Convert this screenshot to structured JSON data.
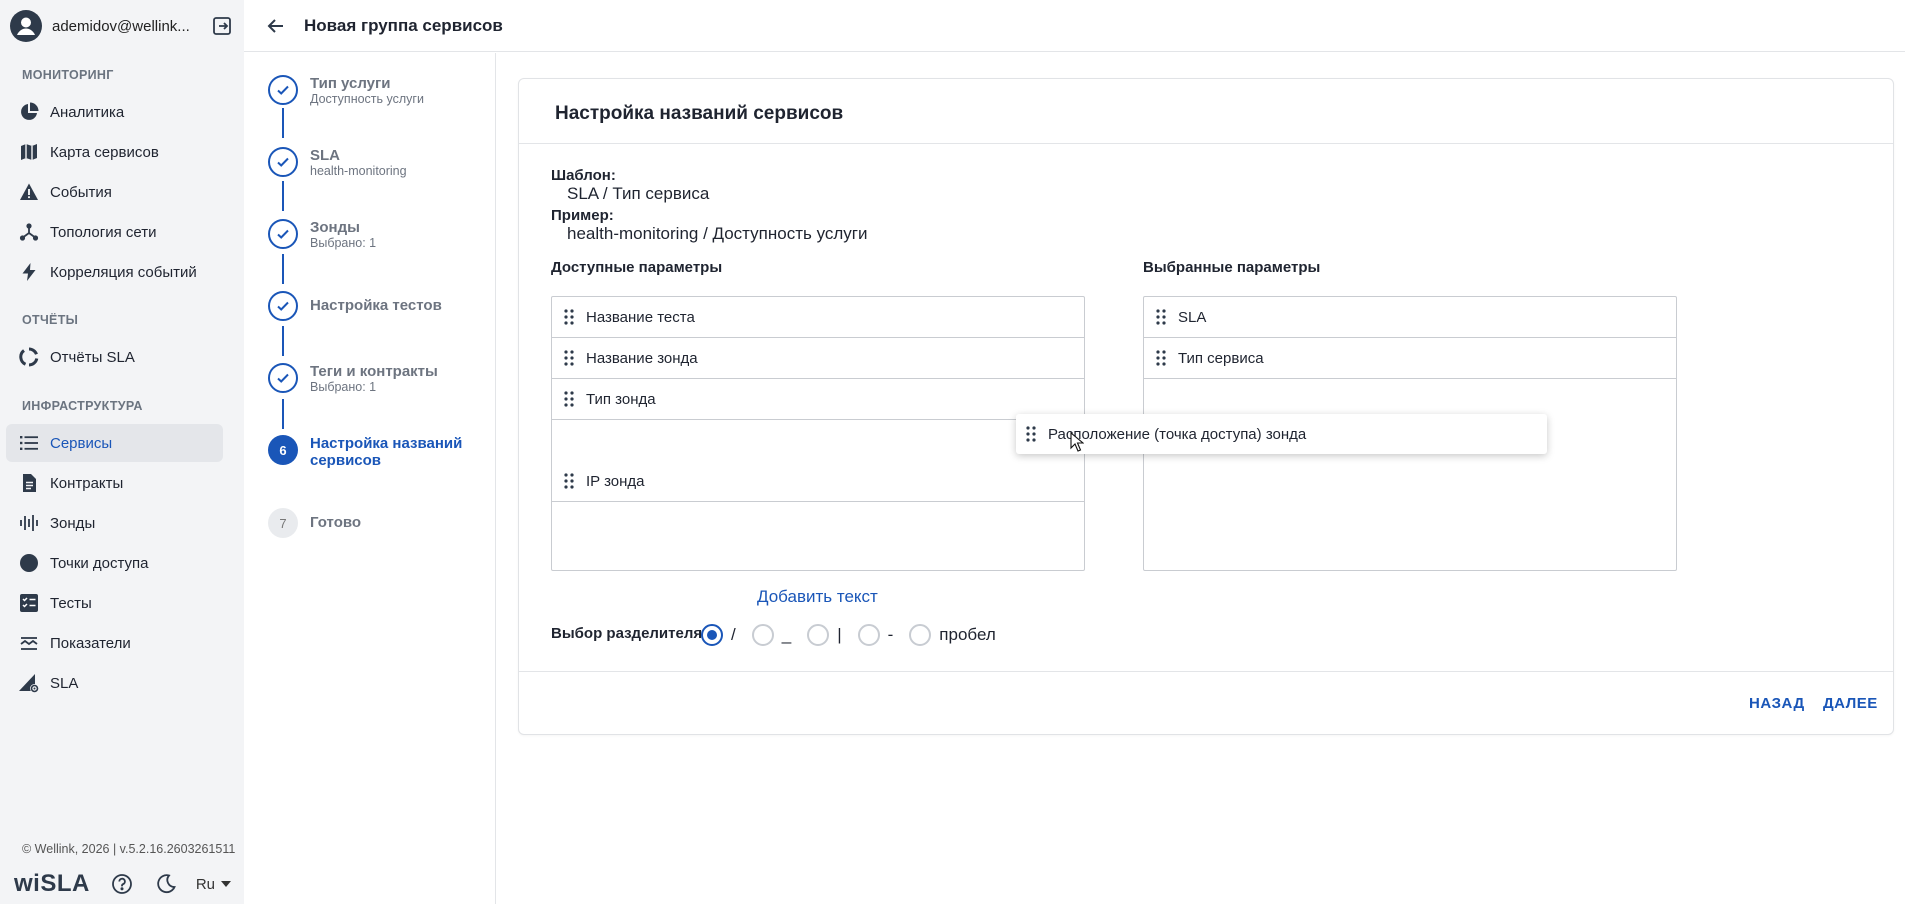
{
  "user": {
    "name": "ademidov@wellink..."
  },
  "sidebar": {
    "sections": [
      {
        "title": "МОНИТОРИНГ"
      },
      {
        "title": "ОТЧЁТЫ"
      },
      {
        "title": "ИНФРАСТРУКТУРА"
      }
    ],
    "items": [
      {
        "label": "Аналитика",
        "icon": "pie-chart-icon"
      },
      {
        "label": "Карта сервисов",
        "icon": "map-icon"
      },
      {
        "label": "События",
        "icon": "warning-icon"
      },
      {
        "label": "Топология сети",
        "icon": "topology-icon"
      },
      {
        "label": "Корреляция событий",
        "icon": "lightning-icon"
      },
      {
        "label": "Отчёты SLA",
        "icon": "report-icon"
      },
      {
        "label": "Сервисы",
        "icon": "list-icon"
      },
      {
        "label": "Контракты",
        "icon": "document-icon"
      },
      {
        "label": "Зонды",
        "icon": "probe-icon"
      },
      {
        "label": "Точки доступа",
        "icon": "access-point-icon"
      },
      {
        "label": "Тесты",
        "icon": "checklist-icon"
      },
      {
        "label": "Показатели",
        "icon": "metrics-icon"
      },
      {
        "label": "SLA",
        "icon": "sla-icon"
      }
    ],
    "copyright": "© Wellink, 2026 | v.5.2.16.2603261511",
    "logo": "wiSLA",
    "language": "Ru"
  },
  "header": {
    "title": "Новая группа сервисов"
  },
  "steps": [
    {
      "title": "Тип услуги",
      "subtitle": "Доступность услуги"
    },
    {
      "title": "SLA",
      "subtitle": "health-monitoring"
    },
    {
      "title": "Зонды",
      "subtitle": "Выбрано: 1"
    },
    {
      "title": "Настройка тестов",
      "subtitle": ""
    },
    {
      "title": "Теги и контракты",
      "subtitle": "Выбрано: 1"
    },
    {
      "title": "Настройка названий сервисов",
      "number": "6"
    },
    {
      "title": "Готово",
      "number": "7"
    }
  ],
  "card": {
    "title": "Настройка названий сервисов",
    "template_label": "Шаблон:",
    "template_value": "SLA / Тип сервиса",
    "example_label": "Пример:",
    "example_value": "health-monitoring / Доступность услуги",
    "available_label": "Доступные параметры",
    "selected_label": "Выбранные параметры",
    "available": [
      "Название теста",
      "Название зонда",
      "Тип зонда",
      "IP зонда"
    ],
    "selected": [
      "SLA",
      "Тип сервиса"
    ],
    "dragging": "Расположение (точка доступа) зонда",
    "add_text": "Добавить текст",
    "separator_label": "Выбор разделителя",
    "separators": [
      "/",
      "_",
      "|",
      "-",
      "пробел"
    ],
    "selected_separator": "/",
    "back_button": "НАЗАД",
    "next_button": "ДАЛЕЕ"
  },
  "colors": {
    "accent": "#1a56b8",
    "sidebar_bg": "#f3f4f6"
  }
}
